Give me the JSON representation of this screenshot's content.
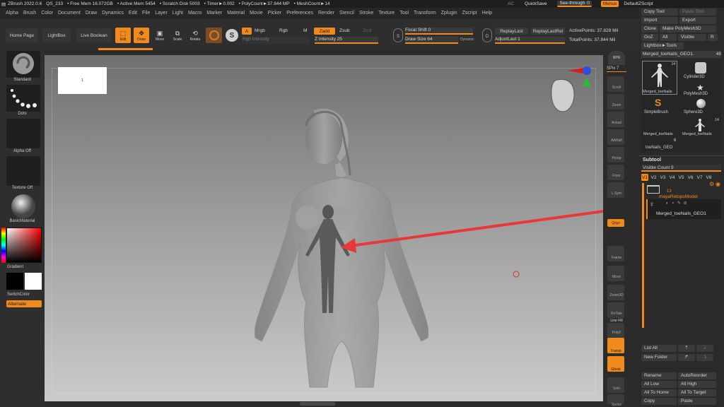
{
  "title_bar": {
    "app": "ZBrush 2022.0.6",
    "doc": "QS_233",
    "free_mem": "• Free Mem 16.072GB",
    "active_mem": "• Active Mem 5454",
    "scratch": "• Scratch Disk 5003",
    "timer": "• Timer►0.002",
    "polycount": "• PolyCount►37.844 MP",
    "meshcount": "• MeshCount►14",
    "ac": "AC",
    "quicksave": "QuickSave",
    "seethrough": "See-through",
    "seethrough_val": "0",
    "menus": "Menus",
    "script": "DefaultZScript"
  },
  "menu": [
    "Alpha",
    "Brush",
    "Color",
    "Document",
    "Draw",
    "Dynamics",
    "Edit",
    "File",
    "Layer",
    "Light",
    "Macro",
    "Marker",
    "Material",
    "Movie",
    "Picker",
    "Preferences",
    "Render",
    "Stencil",
    "Stroke",
    "Texture",
    "Tool",
    "Transform",
    "Zplugin",
    "Zscript",
    "Help"
  ],
  "toolbar": {
    "home": "Home Page",
    "lightbox": "LightBox",
    "live_boolean": "Live Boolean",
    "edit": "Edit",
    "draw": "Draw",
    "move": "Move",
    "scale": "Scale",
    "rotate": "Rotate",
    "a": "A",
    "mrgb": "Mrgb",
    "rgb": "Rgb",
    "m": "M",
    "zadd": "Zadd",
    "zsub": "Zsub",
    "zcut": "Zcut",
    "rgb_intensity": "Rgb Intensity",
    "z_intensity": "Z Intensity 25",
    "focal_shift": "Focal Shift 0",
    "draw_size": "Draw Size 64",
    "dynamic": "Dynamic",
    "replay_last": "ReplayLast",
    "replay_last_rel": "ReplayLastRel",
    "adjust_last": "AdjustLast 1",
    "active_points": "ActivePoints: 37.828 Mil",
    "total_points": "TotalPoints: 37.844 Mil",
    "s_icon": "S",
    "d_icon": "D"
  },
  "left_shelf": {
    "standard": "Standard",
    "dots": "Dots",
    "alpha": "Alpha Off",
    "texture": "Texture Off",
    "material": "BasicMaterial",
    "gradient": "Gradient",
    "switch_color": "SwitchColor",
    "alternate": "Alternate"
  },
  "viewport": {
    "doc_thumb_label": "1"
  },
  "right_shelf": {
    "bpr": "BPR",
    "spix": "SPix 7",
    "scroll": "Scroll",
    "zoom": "Zoom",
    "actual": "Actual",
    "aahalf": "AAHalf",
    "persp": "Persp",
    "floor": "Floor",
    "lsym": "L.Sym",
    "xyz": "Qxyz",
    "frame": "Frame",
    "move": "Move",
    "zoom3d": "Zoom3D",
    "rotate": "RoTate",
    "linefill": "Line Fill",
    "polyf": "PolyF",
    "transp": "Transp",
    "ghost": "Ghost",
    "solo": "Solo",
    "xpose": "Xpose"
  },
  "tool_palette": {
    "copy_tool": "Copy Tool",
    "paste_tool": "Paste Tool",
    "import": "Import",
    "export": "Export",
    "clone": "Clone",
    "make_polymesh": "Make PolyMesh3D",
    "goz": "GoZ",
    "all": "All",
    "visible": "Visible",
    "r": "R",
    "lightbox_tools": "Lightbox►Tools",
    "current_tool": "Merged_toeNails_GEO1.",
    "current_tool_count": "48",
    "thumbs": [
      {
        "label": "Merged_toeNails",
        "count": "14"
      },
      {
        "label": "PolyMesh3D",
        "count": ""
      },
      {
        "label": "SimpleBrush",
        "count": ""
      },
      {
        "label": "Sphere3D",
        "count": ""
      },
      {
        "label": "Merged_toeNails",
        "count": ""
      },
      {
        "label": "Merged_toeNails",
        "count": "14"
      },
      {
        "label": "Cylinder3D",
        "count": ""
      }
    ],
    "extra": "toeNails_GEO",
    "extra_count": "6"
  },
  "subtool": {
    "header": "Subtool",
    "visible_count": "Visible Count 9",
    "versions": [
      "V1",
      "V2",
      "V3",
      "V4",
      "V5",
      "V6",
      "V7",
      "V8"
    ],
    "folder_name": "mayaRetopoModel",
    "folder_count": "13",
    "item_name": "Merged_toeNails_GEO1",
    "list_all": "List All",
    "new_folder": "New Folder",
    "rename": "Rename",
    "auto_reorder": "AutoReorder",
    "all_low": "All Low",
    "all_high": "All High",
    "all_to_home": "All To Home",
    "all_to_target": "All To Target",
    "copy": "Copy",
    "paste": "Paste"
  },
  "colors": {
    "accent": "#f08a1c",
    "arrow": "#e8383a"
  }
}
